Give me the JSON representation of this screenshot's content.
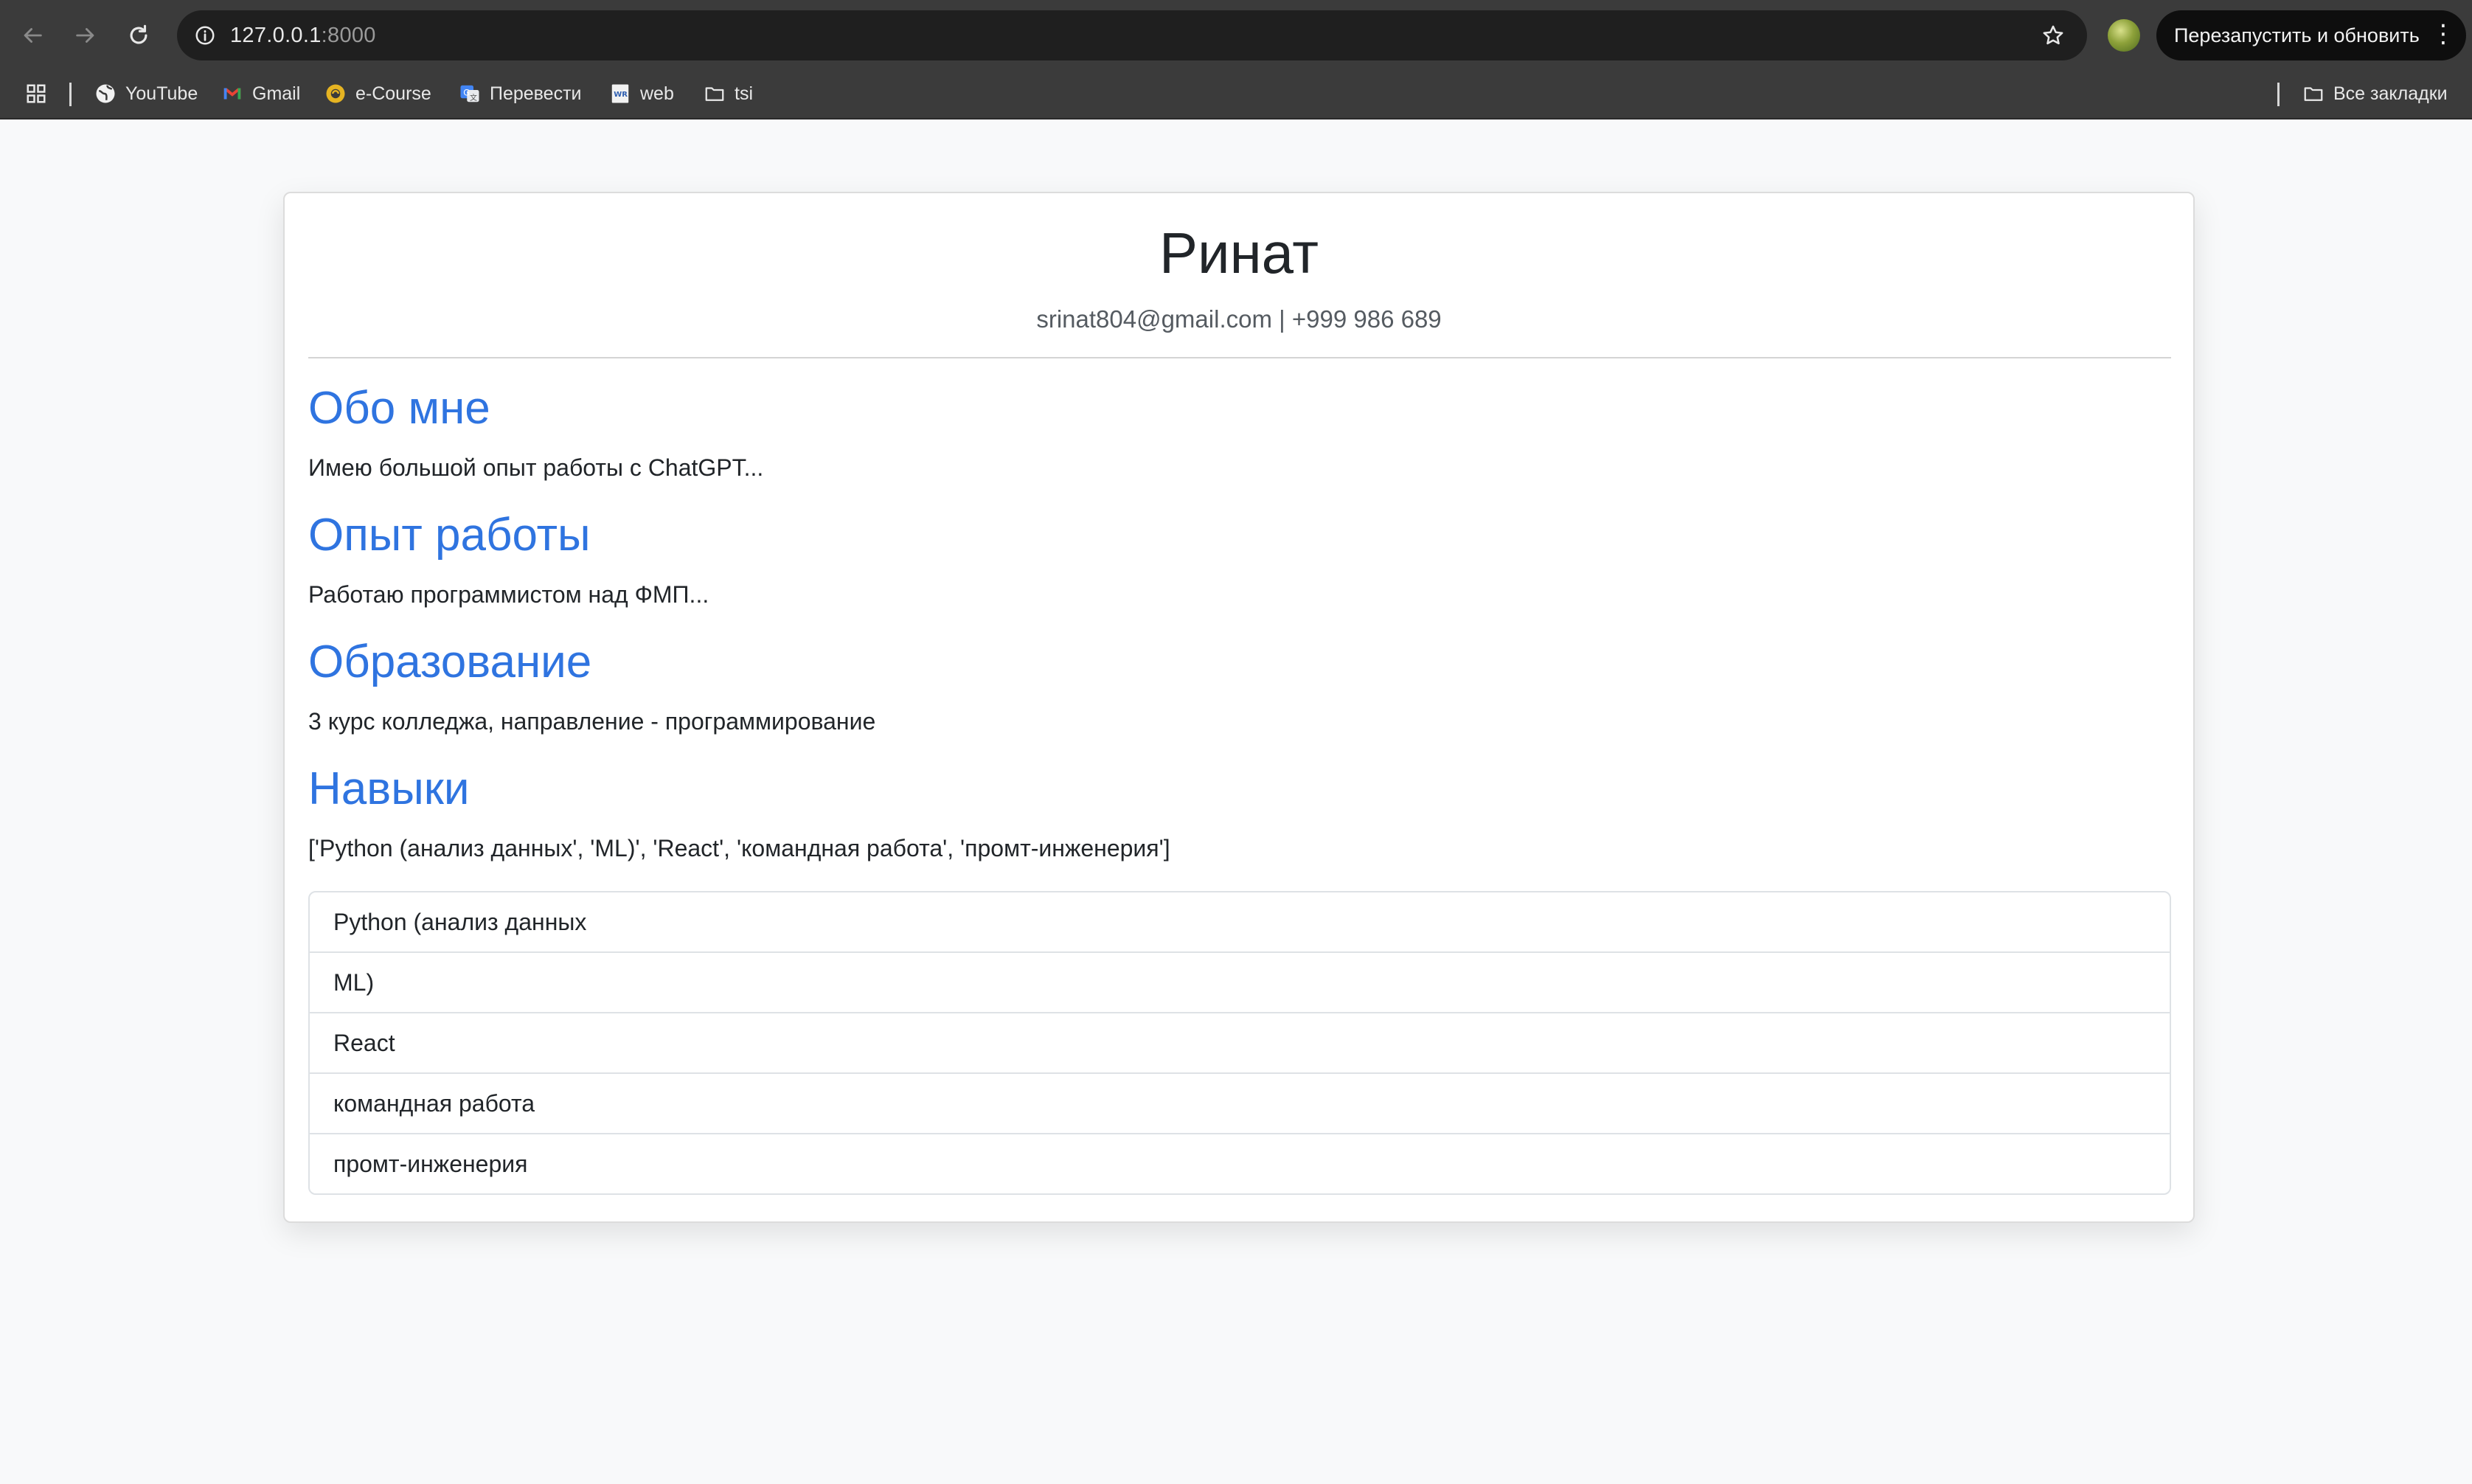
{
  "browser": {
    "url_host": "127.0.0.1",
    "url_port": ":8000",
    "relaunch_label": "Перезапустить и обновить",
    "bookmarks": [
      "YouTube",
      "Gmail",
      "e-Course",
      "Перевести",
      "web",
      "tsi"
    ],
    "all_bookmarks_label": "Все закладки",
    "accent_color": "#0e0e0e"
  },
  "resume": {
    "name": "Ринат",
    "contact": "srinat804@gmail.com | +999 986 689",
    "sections": [
      {
        "title": "Обо мне",
        "text": "Имею большой опыт работы с ChatGPT..."
      },
      {
        "title": "Опыт работы",
        "text": "Работаю программистом над ФМП..."
      },
      {
        "title": "Образование",
        "text": "3 курс колледжа, направление - программирование"
      },
      {
        "title": "Навыки",
        "text": "['Python (анализ данных', 'ML)', 'React', 'командная работа', 'промт-инженерия']"
      }
    ],
    "skills": [
      "Python (анализ данных",
      "ML)",
      "React",
      "командная работа",
      "промт-инженерия"
    ],
    "heading_color": "#2f74e0"
  }
}
